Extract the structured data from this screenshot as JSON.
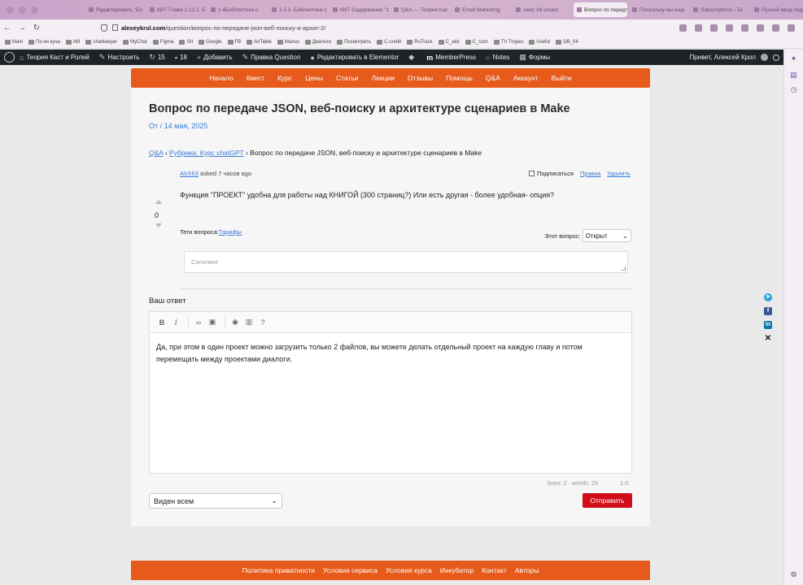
{
  "browser": {
    "tabs": [
      "Редактировать \"Бо",
      "КИТ Глава 1.12.1: Бо",
      "1.4Библиотека с",
      "1.5.1. Библиотека с",
      "КИТ Содержание \"1",
      "Q&A — Теория Кас",
      "Email Marketing",
      "view: All unsen",
      "Вопрос по перед",
      "Поскольку вы ище",
      "Subscriptions - Ta",
      "Ручной ввод подпи"
    ],
    "active_tab_index": 8,
    "url_domain": "alexeykrol.com",
    "url_path": "/question/вопрос-по-передаче-json-веб-поиску-и-архит-2/",
    "bookmarks": [
      "Main",
      "По ин куча",
      "ИИ",
      "chatkeeper",
      "MyChat",
      "Figma",
      "Git",
      "Google",
      "FB",
      "AirTable",
      "Manus",
      "Диалоги",
      "Посмотреть",
      "C-credit",
      "RuTrack",
      "C_akk",
      "C_com",
      "TV Tropes",
      "Useful",
      "DB_04"
    ]
  },
  "adminbar": {
    "site_name": "Теория Каст и Ролей",
    "customize": "Настроить",
    "updates_count": "15",
    "comments_count": "18",
    "add_new": "Добавить",
    "edit_question": "Правка Question",
    "elementor": "Редактировать в Elementor",
    "memberpress": "MemberPress",
    "notes": "Notes",
    "forms": "Формы",
    "greeting": "Привет, Алексей Крол"
  },
  "mainnav": [
    "Начало",
    "Квест",
    "Курс",
    "Цены",
    "Статьи",
    "Лекции",
    "Отзывы",
    "Помощь",
    "Q&A",
    "Аккаунт",
    "Выйти"
  ],
  "question": {
    "title": "Вопрос по передаче JSON, веб-поиску и архитектуре сценариев в Make",
    "meta": "От / 14 мая, 2025",
    "breadcrumb": {
      "root": "Q&A",
      "sep1": " › ",
      "category": "Рубрика: Курс chatGPT",
      "sep2": " › ",
      "current": "Вопрос по передаче JSON, веб-поиску и архитектуре сценариев в Make"
    },
    "author": "Alch63",
    "asked": " asked 7 часов ago",
    "subscribe": "Подписаться",
    "edit": "Правка",
    "delete": "Удалить",
    "votes": "0",
    "body": "Функция \"ПРОЕКТ\" удобна для работы над КНИГОЙ (300 страниц?) Или есть другая - более удобная- опция?",
    "tags_label": "Теги вопроса:",
    "tag": "Тарифы",
    "status_label": "Этот вопрос:",
    "status_value": "Открыт",
    "comment_placeholder": "Comment"
  },
  "answer": {
    "heading": "Ваш ответ",
    "text_line1": "Да, при этом в один проект можно загрузить только 2 файлов, вы можете делать отдельный проект на каждую главу и потом",
    "text_line2": "перемещать между проектами диалоги.",
    "lines": "lines: 2",
    "words": "words: 25",
    "cursor": "1:0",
    "visibility": "Виден всем",
    "submit": "Отправить"
  },
  "footer": [
    "Политика приватности",
    "Условия сервиса",
    "Условия курса",
    "Инкубатор",
    "Контакт",
    "Авторы"
  ],
  "colors": {
    "brand_orange": "#e65b1b",
    "submit_red": "#d10d1a",
    "link_blue": "#3a7bd5"
  }
}
